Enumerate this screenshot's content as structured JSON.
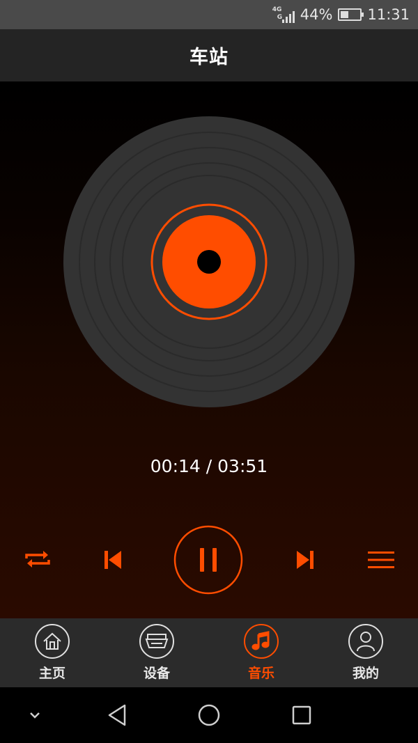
{
  "status_bar": {
    "network": "4G",
    "network_secondary": "G",
    "battery_percent": "44%",
    "battery_level": 0.44,
    "time": "11:31"
  },
  "header": {
    "title": "车站"
  },
  "player": {
    "elapsed": "00:14",
    "separator": " / ",
    "duration": "03:51",
    "is_playing": true
  },
  "controls": {
    "repeat": "repeat-icon",
    "previous": "skip-previous-icon",
    "pause": "pause-icon",
    "next": "skip-next-icon",
    "playlist": "playlist-icon"
  },
  "bottom_nav": {
    "items": [
      {
        "label": "主页",
        "icon": "home-icon"
      },
      {
        "label": "设备",
        "icon": "device-icon"
      },
      {
        "label": "音乐",
        "icon": "music-note-icon"
      },
      {
        "label": "我的",
        "icon": "profile-icon"
      }
    ],
    "active": "音乐"
  },
  "system_nav": {
    "down": "chevron-down-icon",
    "back": "back-triangle-icon",
    "home": "home-circle-icon",
    "recents": "recents-square-icon"
  },
  "colors": {
    "accent": "#ff4d00",
    "disc": "#333333",
    "title_bar": "#242424",
    "nav_bar": "#2b2b2b",
    "status_bar": "#4a4a4a"
  }
}
